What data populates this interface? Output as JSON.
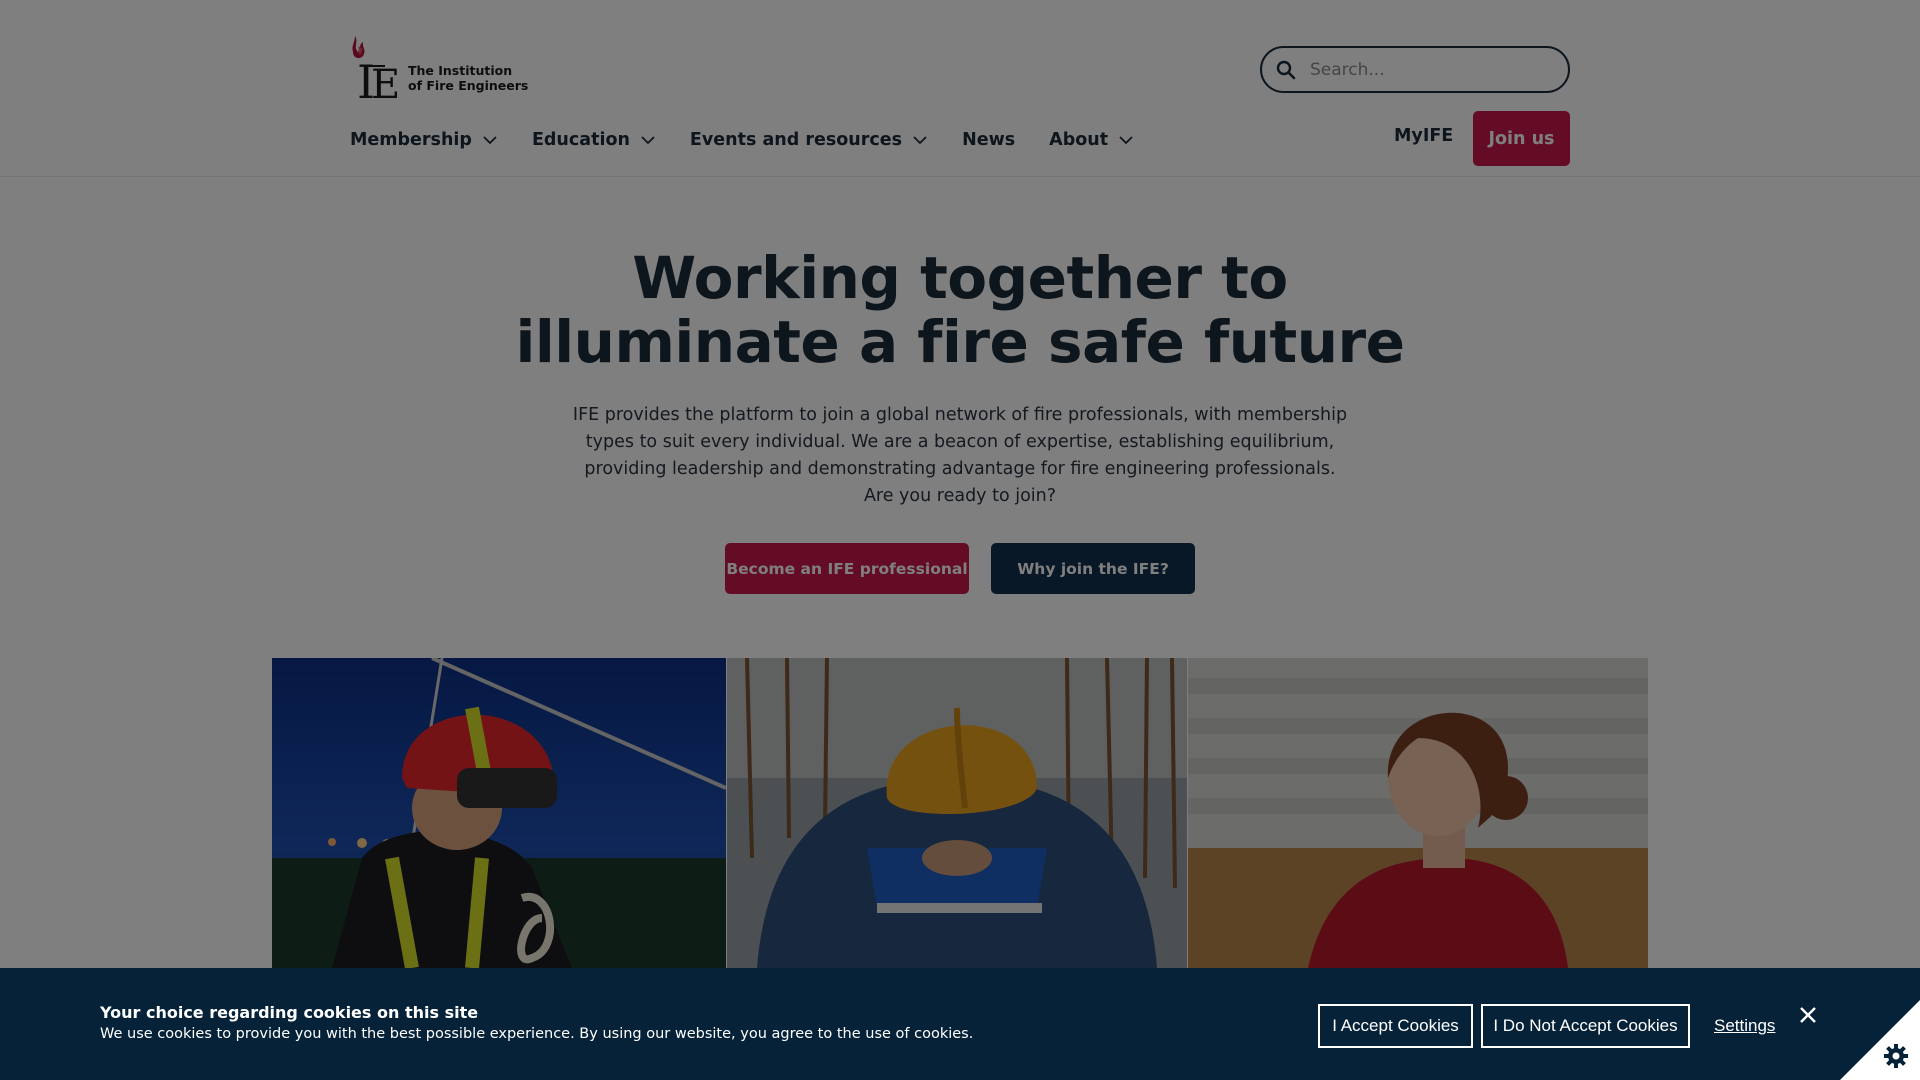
{
  "header": {
    "logo": {
      "mark": "IFE",
      "line1": "The Institution",
      "line2": "of Fire Engineers"
    },
    "search": {
      "placeholder": "Search..."
    },
    "nav": [
      {
        "label": "Membership",
        "dropdown": true
      },
      {
        "label": "Education",
        "dropdown": true
      },
      {
        "label": "Events and resources",
        "dropdown": true
      },
      {
        "label": "News",
        "dropdown": false
      },
      {
        "label": "About",
        "dropdown": true
      }
    ],
    "myife_label": "MyIFE",
    "join_label": "Join us"
  },
  "hero": {
    "title_line1": "Working together to",
    "title_line2": "illuminate a fire safe future",
    "text_line1": "IFE provides the platform to join a global network of fire professionals, with membership",
    "text_line2": "types to suit every individual. We are a beacon of expertise, establishing equilibrium,",
    "text_line3": "providing leadership and demonstrating advantage for fire engineering professionals.",
    "text_line4": "Are you ready to join?",
    "primary_button": "Become an IFE professional",
    "secondary_button": "Why join the IFE?"
  },
  "photos": [
    {
      "icon": "firefighter-photo"
    },
    {
      "icon": "construction-worker-photo"
    },
    {
      "icon": "woman-professional-photo"
    }
  ],
  "cookie": {
    "title": "Your choice regarding cookies on this site",
    "text": "We use cookies to provide you with the best possible experience. By using our website, you agree to the use of cookies.",
    "accept_label": "I Accept Cookies",
    "decline_label": "I Do Not Accept Cookies",
    "settings_label": "Settings"
  },
  "colors": {
    "brand_red": "#c8194b",
    "navy": "#13304d",
    "banner": "#062238",
    "text": "#1b2a3a"
  }
}
